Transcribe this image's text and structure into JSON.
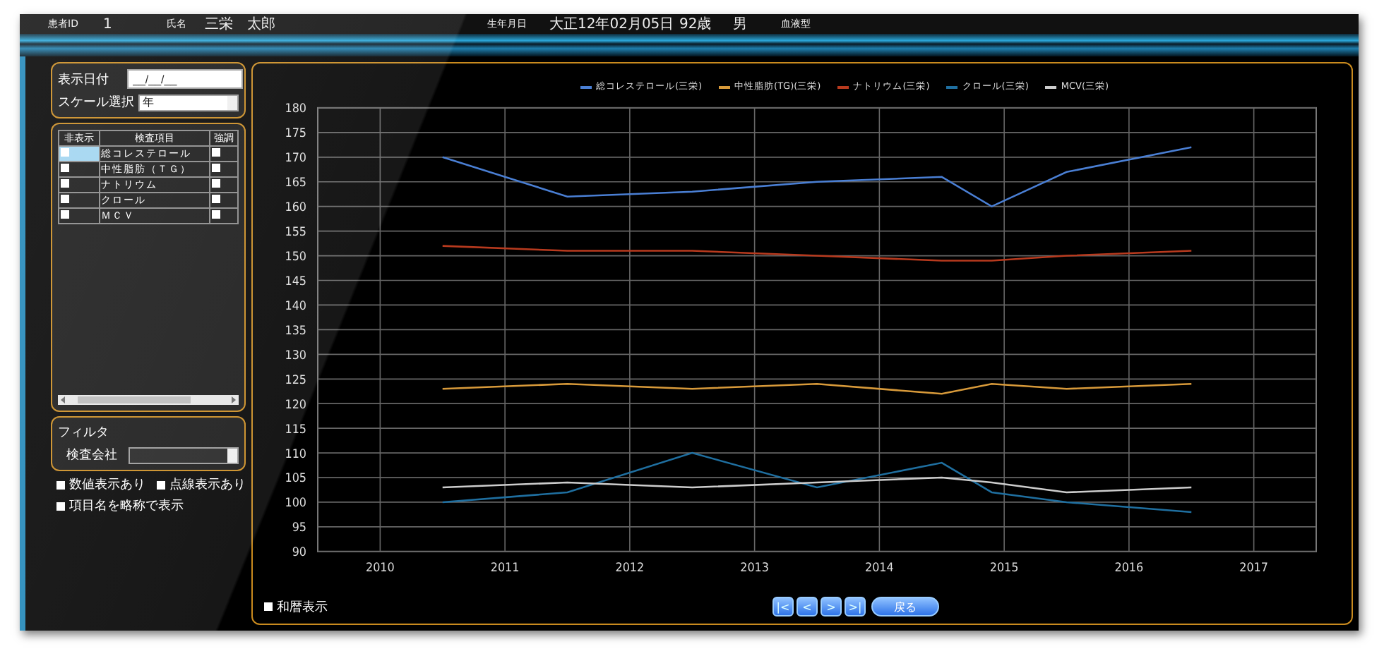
{
  "header": {
    "items": [
      {
        "kind": "label",
        "text": "患者ID"
      },
      {
        "kind": "value",
        "text": "1"
      },
      {
        "kind": "label",
        "text": "氏名"
      },
      {
        "kind": "value",
        "text": "三栄　太郎"
      },
      {
        "kind": "label",
        "text": "生年月日"
      },
      {
        "kind": "value",
        "text": "大正12年02月05日"
      },
      {
        "kind": "value",
        "text": "92歳"
      },
      {
        "kind": "value",
        "text": "男"
      },
      {
        "kind": "label",
        "text": "血液型"
      }
    ]
  },
  "display": {
    "date_label": "表示日付",
    "date_value": "__/__/__",
    "scale_label": "スケール選択",
    "scale_value": "年"
  },
  "items_table": {
    "columns": [
      "非表示",
      "検査項目",
      "強調"
    ],
    "rows": [
      {
        "name": "総コレステロール",
        "hidden": false,
        "emphasized": false,
        "selected": true
      },
      {
        "name": "中性脂肪（ＴＧ）",
        "hidden": false,
        "emphasized": false,
        "selected": false
      },
      {
        "name": "ナトリウム",
        "hidden": false,
        "emphasized": false,
        "selected": false
      },
      {
        "name": "クロール",
        "hidden": false,
        "emphasized": false,
        "selected": false
      },
      {
        "name": "ＭＣＶ",
        "hidden": false,
        "emphasized": false,
        "selected": false
      }
    ]
  },
  "filter": {
    "title": "フィルタ",
    "company_label": "検査会社"
  },
  "options": [
    {
      "label": "数値表示あり",
      "checked": false
    },
    {
      "label": "点線表示あり",
      "checked": false
    },
    {
      "label": "項目名を略称で表示",
      "checked": false
    }
  ],
  "chart": {
    "chart_data": {
      "type": "line",
      "grid": true,
      "x": [
        2010.5,
        2011.5,
        2012.5,
        2013.5,
        2014.5,
        2014.9,
        2015.5,
        2016.5
      ],
      "xlim": [
        2009.5,
        2017.5
      ],
      "ylim": [
        90,
        180
      ],
      "xticks": [
        2010,
        2011,
        2012,
        2013,
        2014,
        2015,
        2016,
        2017
      ],
      "yticks": [
        90,
        95,
        100,
        105,
        110,
        115,
        120,
        125,
        130,
        135,
        140,
        145,
        150,
        155,
        160,
        165,
        170,
        175,
        180
      ],
      "series": [
        {
          "name": "総コレステロール(三栄)",
          "color": "#4a7fd4",
          "values": [
            170,
            162,
            163,
            165,
            166,
            160,
            167,
            172
          ]
        },
        {
          "name": "中性脂肪(TG)(三栄)",
          "color": "#d89a3a",
          "values": [
            123,
            124,
            123,
            124,
            122,
            124,
            123,
            124
          ]
        },
        {
          "name": "ナトリウム(三栄)",
          "color": "#b83a1e",
          "values": [
            152,
            151,
            151,
            150,
            149,
            149,
            150,
            151
          ]
        },
        {
          "name": "クロール(三栄)",
          "color": "#1f6fa0",
          "values": [
            100,
            102,
            110,
            103,
            108,
            102,
            100,
            98
          ]
        },
        {
          "name": "MCV(三栄)",
          "color": "#cccccc",
          "values": [
            103,
            104,
            103,
            104,
            105,
            104,
            102,
            103
          ]
        }
      ]
    }
  },
  "wareki": {
    "label": "和暦表示",
    "checked": false
  },
  "nav_buttons": [
    "|<",
    "<",
    ">",
    ">|"
  ],
  "back_button": "戻る"
}
